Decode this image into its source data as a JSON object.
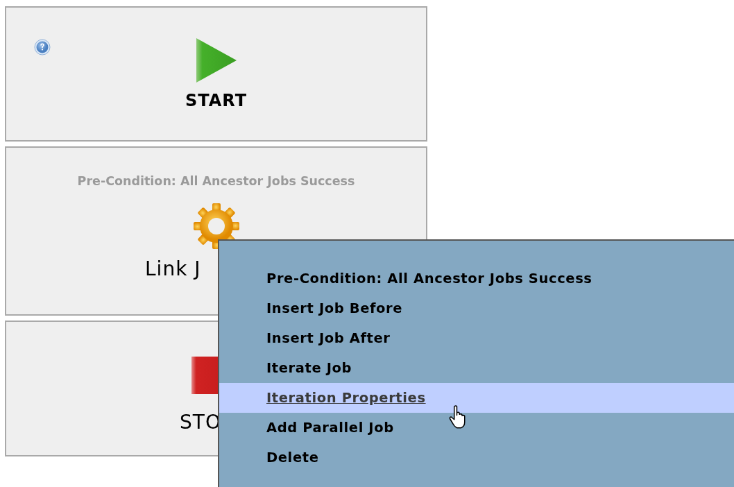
{
  "cards": [
    {
      "kind": "start",
      "label": "START"
    },
    {
      "kind": "link",
      "precondition": "Pre-Condition: All Ancestor Jobs Success",
      "label": "Link J"
    },
    {
      "kind": "stop",
      "label": "STO"
    }
  ],
  "context_menu": {
    "items": [
      {
        "label": "Pre-Condition: All Ancestor Jobs Success",
        "selected": false
      },
      {
        "label": "Insert Job Before",
        "selected": false
      },
      {
        "label": "Insert Job After",
        "selected": false
      },
      {
        "label": "Iterate Job",
        "selected": false
      },
      {
        "label": "Iteration Properties",
        "selected": true
      },
      {
        "label": "Add Parallel Job",
        "selected": false
      },
      {
        "label": "Delete",
        "selected": false
      }
    ]
  }
}
